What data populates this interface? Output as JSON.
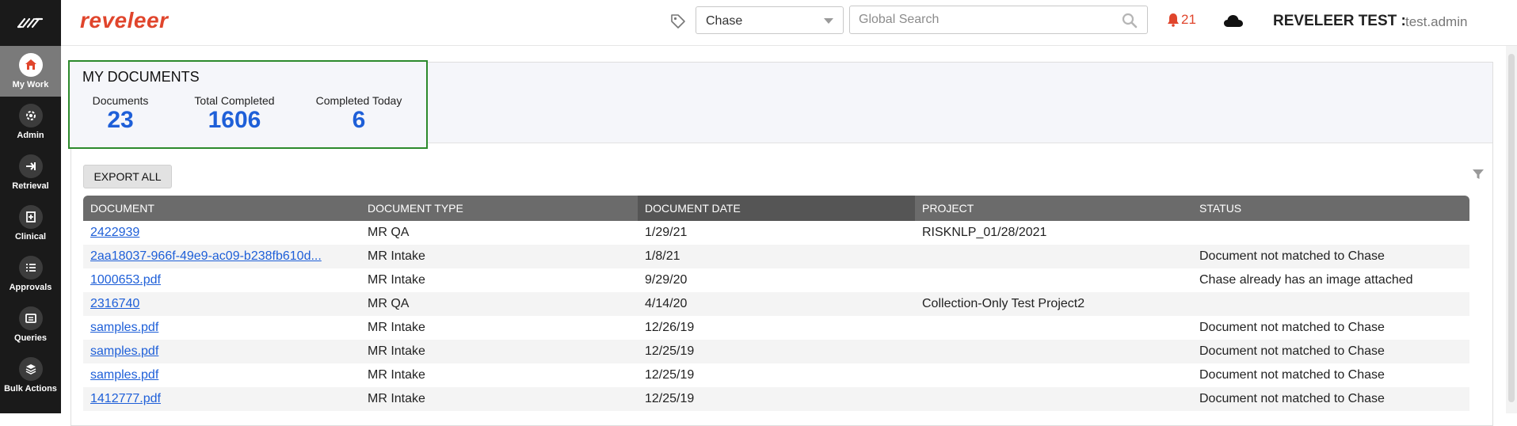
{
  "header": {
    "brand": "reveleer",
    "chase_select_value": "Chase",
    "search_placeholder": "Global Search",
    "notification_count": "21",
    "org": "REVELEER TEST :",
    "user": "test.admin"
  },
  "sidebar": {
    "items": [
      {
        "label": "My Work",
        "icon": "home-icon",
        "active": true
      },
      {
        "label": "Admin",
        "icon": "gear-icon"
      },
      {
        "label": "Retrieval",
        "icon": "arrow-right-icon"
      },
      {
        "label": "Clinical",
        "icon": "clinical-icon"
      },
      {
        "label": "Approvals",
        "icon": "list-icon"
      },
      {
        "label": "Queries",
        "icon": "queries-icon"
      },
      {
        "label": "Bulk Actions",
        "icon": "layers-icon"
      }
    ]
  },
  "summary": {
    "title": "MY DOCUMENTS",
    "metrics": [
      {
        "label": "Documents",
        "value": "23"
      },
      {
        "label": "Total Completed",
        "value": "1606"
      },
      {
        "label": "Completed Today",
        "value": "6"
      }
    ]
  },
  "toolbar": {
    "export_label": "EXPORT ALL"
  },
  "grid": {
    "columns": [
      "DOCUMENT",
      "DOCUMENT TYPE",
      "DOCUMENT DATE",
      "PROJECT",
      "STATUS"
    ],
    "rows": [
      {
        "document": "2422939",
        "type": "MR QA",
        "date": "1/29/21",
        "project": "RISKNLP_01/28/2021",
        "status": ""
      },
      {
        "document": "2aa18037-966f-49e9-ac09-b238fb610d...",
        "type": "MR Intake",
        "date": "1/8/21",
        "project": "",
        "status": "Document not matched to Chase"
      },
      {
        "document": "1000653.pdf",
        "type": "MR Intake",
        "date": "9/29/20",
        "project": "",
        "status": "Chase already has an image attached"
      },
      {
        "document": "2316740",
        "type": "MR QA",
        "date": "4/14/20",
        "project": "Collection-Only Test Project2",
        "status": ""
      },
      {
        "document": "samples.pdf",
        "type": "MR Intake",
        "date": "12/26/19",
        "project": "",
        "status": "Document not matched to Chase"
      },
      {
        "document": "samples.pdf",
        "type": "MR Intake",
        "date": "12/25/19",
        "project": "",
        "status": "Document not matched to Chase"
      },
      {
        "document": "samples.pdf",
        "type": "MR Intake",
        "date": "12/25/19",
        "project": "",
        "status": "Document not matched to Chase"
      },
      {
        "document": "1412777.pdf",
        "type": "MR Intake",
        "date": "12/25/19",
        "project": "",
        "status": "Document not matched to Chase"
      }
    ]
  },
  "colors": {
    "brand": "#e0452c",
    "link": "#1e5fd8",
    "metric": "#1e5fd8",
    "highlight_border": "#2c8a2c",
    "sidebar_bg": "#1a1a1a",
    "grid_header": "#6b6b6b"
  }
}
